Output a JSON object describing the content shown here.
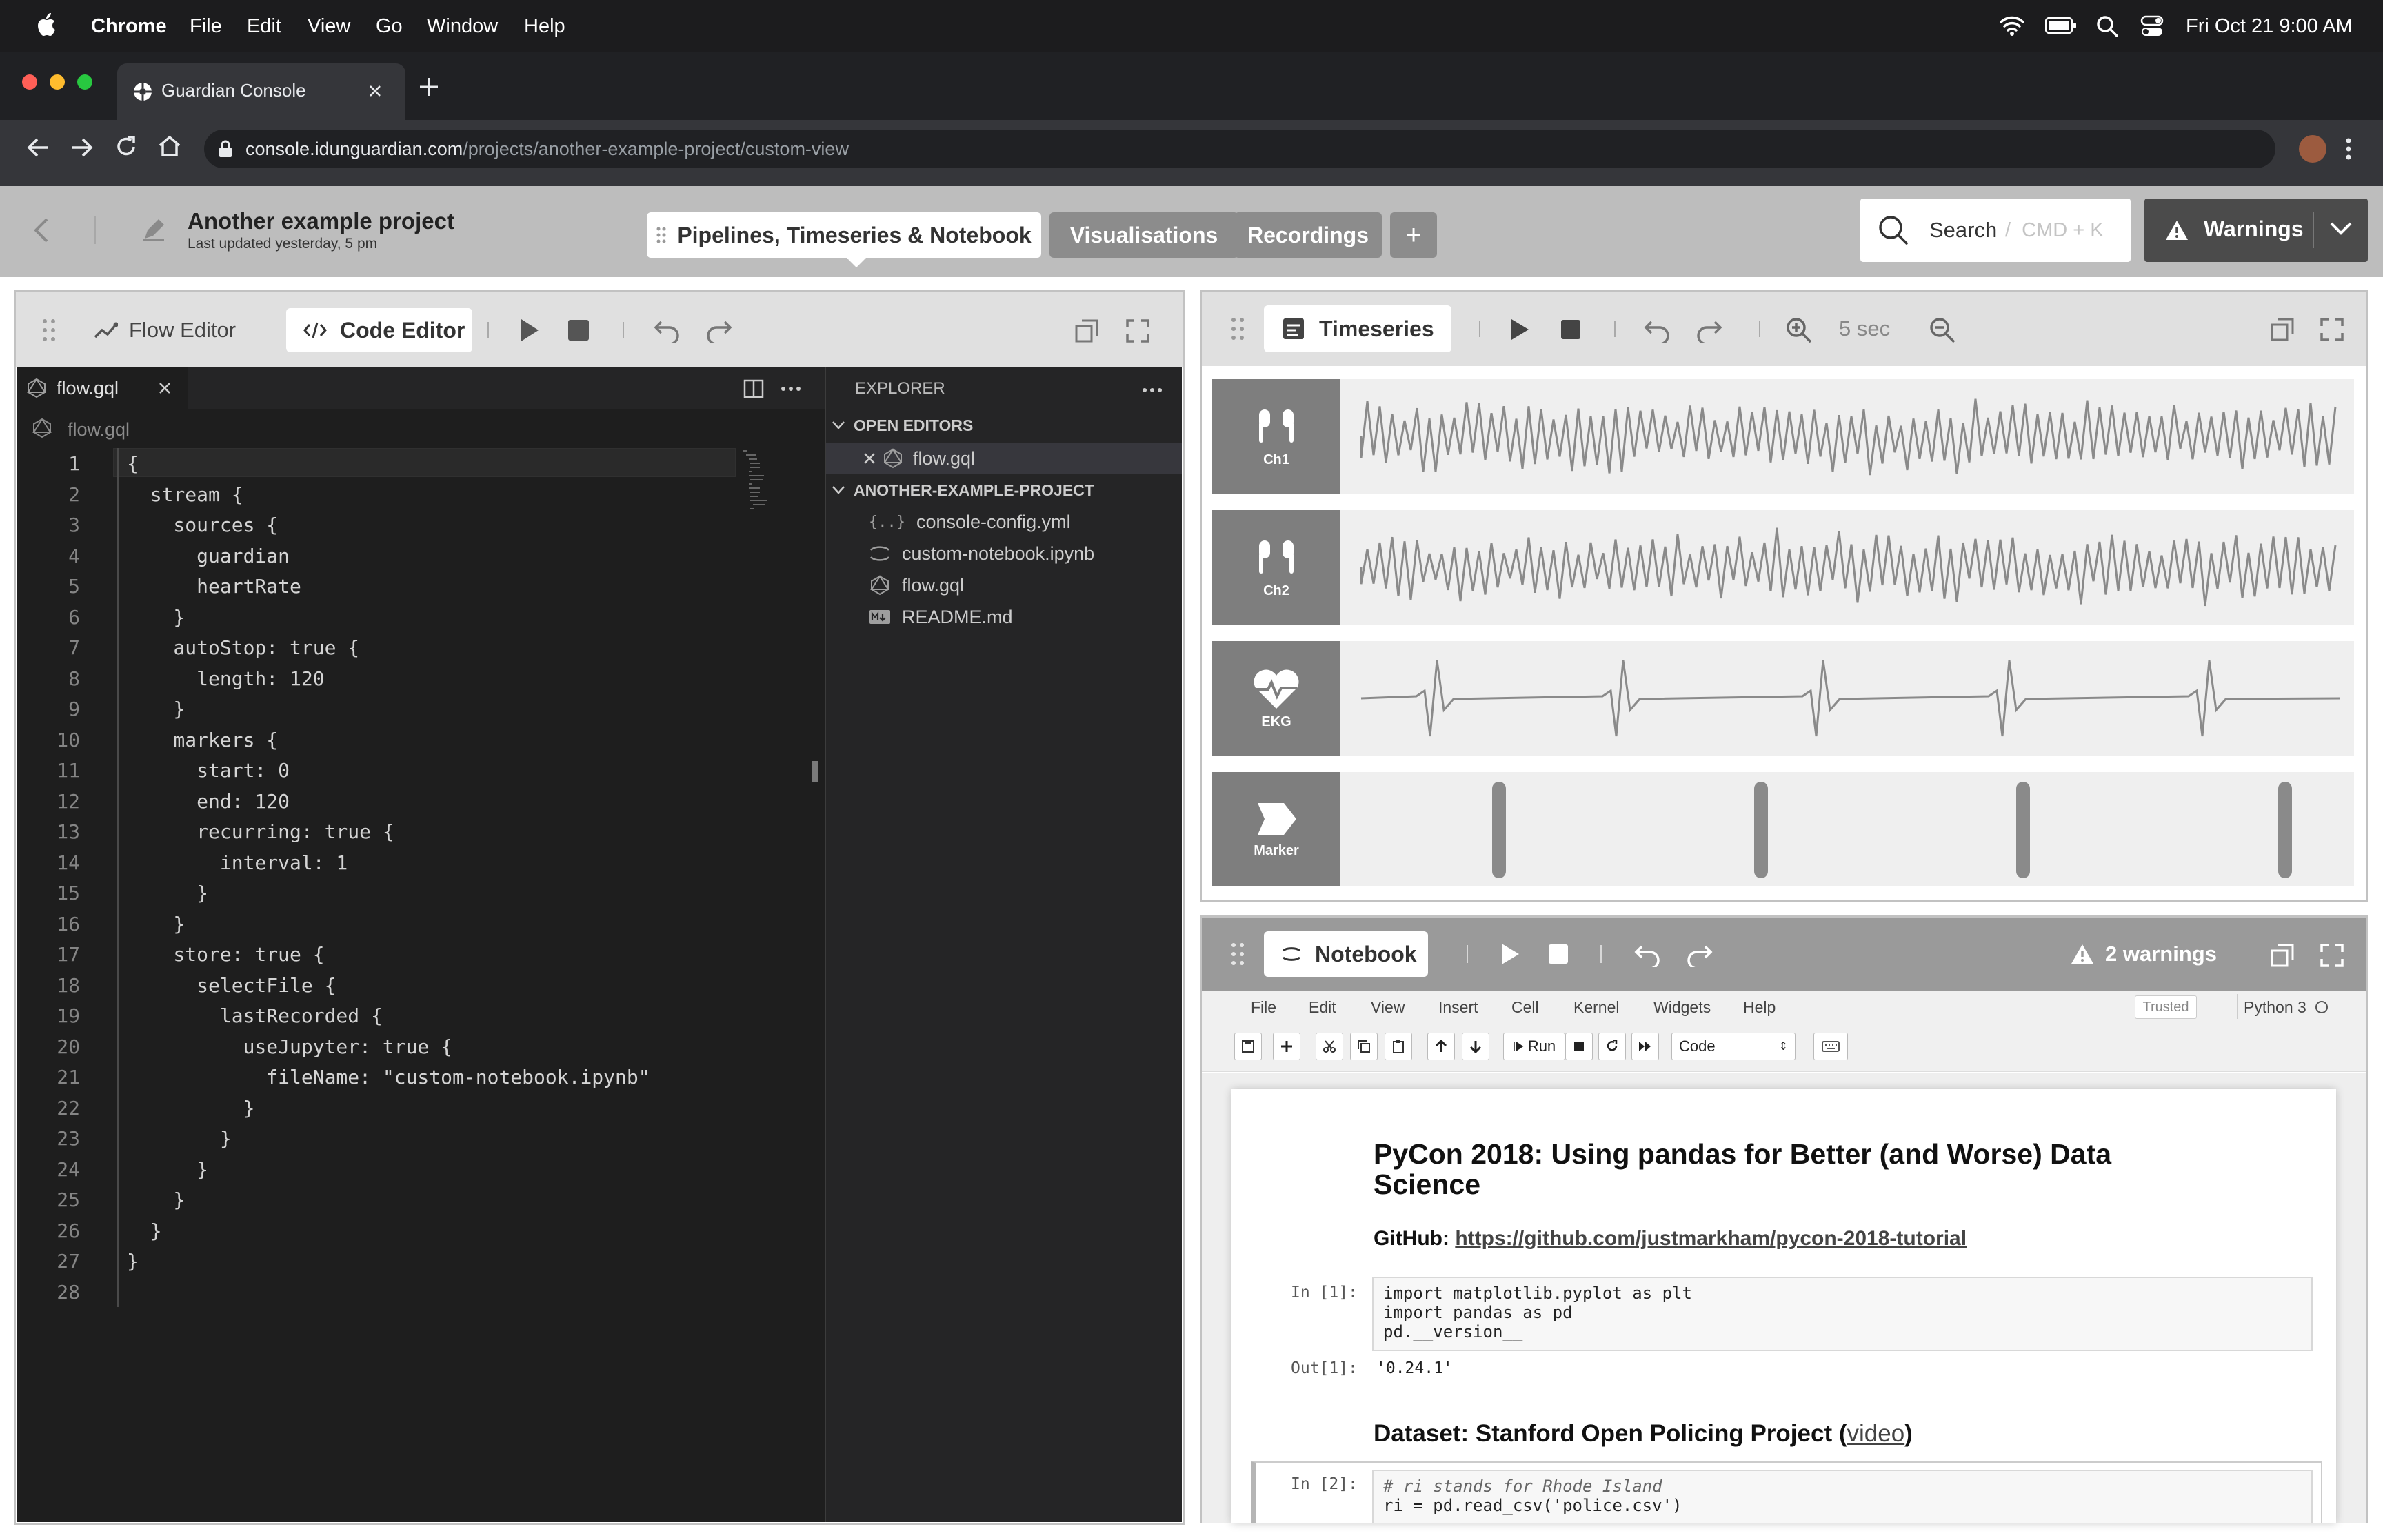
{
  "menubar": {
    "app": "Chrome",
    "items": [
      "File",
      "Edit",
      "View",
      "Go",
      "Window",
      "Help"
    ],
    "clock": "Fri Oct 21  9:00 AM"
  },
  "browser": {
    "tab_title": "Guardian Console",
    "url_host": "console.idunguardian.com",
    "url_path": "/projects/another-example-project/custom-view"
  },
  "header": {
    "project_name": "Another example project",
    "updated": "Last updated yesterday, 5 pm",
    "tabs": [
      {
        "label": "Pipelines, Timeseries & Notebook"
      },
      {
        "label": "Visualisations"
      },
      {
        "label": "Recordings"
      }
    ],
    "add_label": "+",
    "search_label": "Search",
    "search_shortcut": "CMD + K",
    "warnings_label": "Warnings"
  },
  "code_panel": {
    "flow_editor_label": "Flow Editor",
    "code_editor_label": "Code Editor",
    "file_tab": "flow.gql",
    "breadcrumb": "flow.gql",
    "lines": [
      "{",
      "  stream {",
      "    sources {",
      "      guardian",
      "      heartRate",
      "    }",
      "    autoStop: true {",
      "      length: 120",
      "    }",
      "    markers {",
      "      start: 0",
      "      end: 120",
      "      recurring: true {",
      "        interval: 1",
      "      }",
      "    }",
      "    store: true {",
      "      selectFile {",
      "        lastRecorded {",
      "          useJupyter: true {",
      "            fileName: \"custom-notebook.ipynb\"",
      "          }",
      "        }",
      "      }",
      "    }",
      "  }",
      "}",
      ""
    ],
    "explorer": {
      "title": "EXPLORER",
      "open_editors": "OPEN EDITORS",
      "open_file": "flow.gql",
      "project": "ANOTHER-EXAMPLE-PROJECT",
      "files": [
        {
          "icon": "json-icon",
          "name": "console-config.yml"
        },
        {
          "icon": "notebook-icon",
          "name": "custom-notebook.ipynb"
        },
        {
          "icon": "graphql-icon",
          "name": "flow.gql"
        },
        {
          "icon": "markdown-icon",
          "name": "README.md"
        }
      ]
    }
  },
  "timeseries_panel": {
    "label": "Timeseries",
    "window": "5 sec",
    "channels": [
      {
        "label": "Ch1",
        "icon": "earbuds-icon"
      },
      {
        "label": "Ch2",
        "icon": "earbuds-icon"
      },
      {
        "label": "EKG",
        "icon": "heart-icon"
      },
      {
        "label": "Marker",
        "icon": "marker-icon"
      }
    ]
  },
  "notebook_panel": {
    "label": "Notebook",
    "warnings": "2 warnings",
    "menu": [
      "File",
      "Edit",
      "View",
      "Insert",
      "Cell",
      "Kernel",
      "Widgets",
      "Help"
    ],
    "trusted": "Trusted",
    "kernel": "Python 3",
    "run_label": "Run",
    "cell_type": "Code",
    "heading": "PyCon 2018: Using pandas for Better (and Worse) Data Science",
    "github_label": "GitHub:",
    "github_link": "https://github.com/justmarkham/pycon-2018-tutorial",
    "cell1_prompt": "In [1]:",
    "cell1_code": "import matplotlib.pyplot as plt\nimport pandas as pd\npd.__version__",
    "out1_prompt": "Out[1]:",
    "out1_value": "'0.24.1'",
    "dataset_heading": "Dataset: Stanford Open Policing Project (",
    "dataset_link": "video",
    "dataset_close": ")",
    "cell2_prompt": "In [2]:",
    "cell2_comment": "# ri stands for Rhode Island",
    "cell2_code": "ri = pd.read_csv('police.csv')"
  }
}
